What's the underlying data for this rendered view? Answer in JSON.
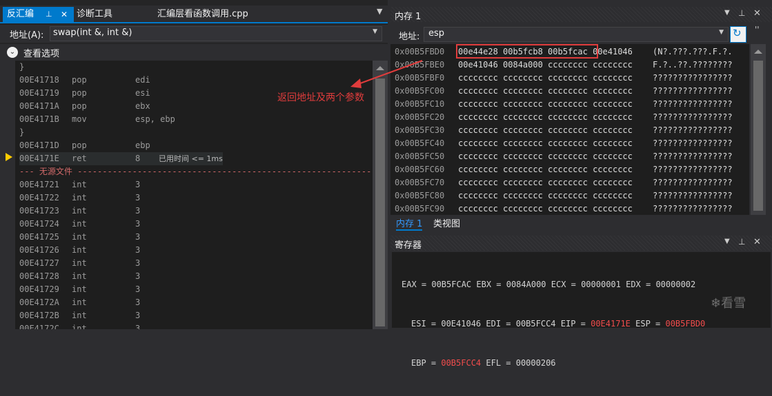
{
  "disasm": {
    "tabs": [
      {
        "label": "反汇编",
        "pin": "⊥",
        "close": "✕"
      },
      {
        "label": "诊断工具"
      },
      {
        "label": "汇编层看函数调用.cpp"
      }
    ],
    "address_label": "地址(A):",
    "address_value": "swap(int &, int &)",
    "view_options": "查看选项",
    "lines": [
      {
        "addr": "}",
        "op": "",
        "arg": ""
      },
      {
        "addr": "00E41718",
        "op": "pop",
        "arg": "edi"
      },
      {
        "addr": "00E41719",
        "op": "pop",
        "arg": "esi"
      },
      {
        "addr": "00E4171A",
        "op": "pop",
        "arg": "ebx"
      },
      {
        "addr": "00E4171B",
        "op": "mov",
        "arg": "esp, ebp"
      },
      {
        "addr": "}",
        "op": "",
        "arg": ""
      },
      {
        "addr": "00E4171D",
        "op": "pop",
        "arg": "ebp"
      },
      {
        "addr": "00E4171E",
        "op": "ret",
        "arg": "8",
        "note": "已用时间 <= 1ms"
      },
      {
        "sep": "--- 无源文件 -------------------------------------------------------------------"
      },
      {
        "addr": "00E41721",
        "op": "int",
        "arg": "3"
      },
      {
        "addr": "00E41722",
        "op": "int",
        "arg": "3"
      },
      {
        "addr": "00E41723",
        "op": "int",
        "arg": "3"
      },
      {
        "addr": "00E41724",
        "op": "int",
        "arg": "3"
      },
      {
        "addr": "00E41725",
        "op": "int",
        "arg": "3"
      },
      {
        "addr": "00E41726",
        "op": "int",
        "arg": "3"
      },
      {
        "addr": "00E41727",
        "op": "int",
        "arg": "3"
      },
      {
        "addr": "00E41728",
        "op": "int",
        "arg": "3"
      },
      {
        "addr": "00E41729",
        "op": "int",
        "arg": "3"
      },
      {
        "addr": "00E4172A",
        "op": "int",
        "arg": "3"
      },
      {
        "addr": "00E4172B",
        "op": "int",
        "arg": "3"
      },
      {
        "addr": "00E4172C",
        "op": "int",
        "arg": "3"
      }
    ]
  },
  "memory": {
    "title": "内存 1",
    "address_label": "地址:",
    "address_value": "esp",
    "rows": [
      {
        "addr": "0x00B5FBD0",
        "bytes": "00e44e28 00b5fcb8 00b5fcac 00e41046",
        "ascii": "(N?.???.???.F.?."
      },
      {
        "addr": "0x00B5FBE0",
        "bytes": "00e41046 0084a000 cccccccc cccccccc",
        "ascii": "F.?..??.????????"
      },
      {
        "addr": "0x00B5FBF0",
        "bytes": "cccccccc cccccccc cccccccc cccccccc",
        "ascii": "????????????????"
      },
      {
        "addr": "0x00B5FC00",
        "bytes": "cccccccc cccccccc cccccccc cccccccc",
        "ascii": "????????????????"
      },
      {
        "addr": "0x00B5FC10",
        "bytes": "cccccccc cccccccc cccccccc cccccccc",
        "ascii": "????????????????"
      },
      {
        "addr": "0x00B5FC20",
        "bytes": "cccccccc cccccccc cccccccc cccccccc",
        "ascii": "????????????????"
      },
      {
        "addr": "0x00B5FC30",
        "bytes": "cccccccc cccccccc cccccccc cccccccc",
        "ascii": "????????????????"
      },
      {
        "addr": "0x00B5FC40",
        "bytes": "cccccccc cccccccc cccccccc cccccccc",
        "ascii": "????????????????"
      },
      {
        "addr": "0x00B5FC50",
        "bytes": "cccccccc cccccccc cccccccc cccccccc",
        "ascii": "????????????????"
      },
      {
        "addr": "0x00B5FC60",
        "bytes": "cccccccc cccccccc cccccccc cccccccc",
        "ascii": "????????????????"
      },
      {
        "addr": "0x00B5FC70",
        "bytes": "cccccccc cccccccc cccccccc cccccccc",
        "ascii": "????????????????"
      },
      {
        "addr": "0x00B5FC80",
        "bytes": "cccccccc cccccccc cccccccc cccccccc",
        "ascii": "????????????????"
      },
      {
        "addr": "0x00B5FC90",
        "bytes": "cccccccc cccccccc cccccccc cccccccc",
        "ascii": "????????????????"
      }
    ],
    "bottom_tabs": [
      "内存 1",
      "类视图"
    ]
  },
  "annotation": {
    "text": "返回地址及两个参数",
    "color": "#e03c3c"
  },
  "registers": {
    "title": "寄存器",
    "line1": "EAX = 00B5FCAC EBX = 0084A000 ECX = 00000001 EDX = 00000002",
    "line2a": "ESI = 00E41046 EDI = 00B5FCC4 EIP = ",
    "line2b": "00E4171E",
    "line2c": " ESP = ",
    "line2d": "00B5FBD0",
    "line3a": "EBP = ",
    "line3b": "00B5FCC4",
    "line3c": " EFL = 00000206"
  },
  "watermark": "看雪",
  "colors": {
    "accent": "#007acc",
    "editor_bg": "#1e1e1e",
    "panel_bg": "#2d2d30",
    "changed_value": "#f14c4c"
  }
}
